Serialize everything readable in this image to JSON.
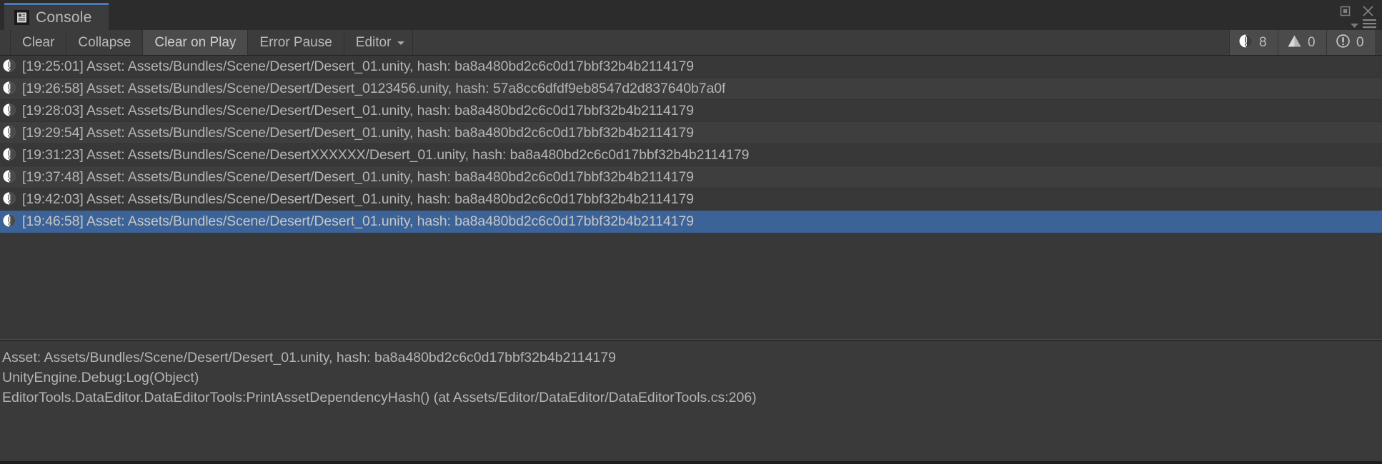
{
  "window": {
    "tab_label": "Console",
    "tab_icon": "console-document-icon",
    "maximize_icon": "maximize-icon",
    "close_icon": "close-icon",
    "menu_caret_icon": "chevron-down-icon",
    "menu_icon": "hamburger-menu-icon",
    "accent_color": "#4a7ab5"
  },
  "toolbar": {
    "clear_label": "Clear",
    "collapse_label": "Collapse",
    "clear_on_play_label": "Clear on Play",
    "error_pause_label": "Error Pause",
    "editor_label": "Editor",
    "editor_caret_icon": "caret-down-icon",
    "counters": [
      {
        "icon": "error-icon",
        "count": "8"
      },
      {
        "icon": "warning-icon",
        "count": "0"
      },
      {
        "icon": "info-icon",
        "count": "0"
      }
    ]
  },
  "log": {
    "entries": [
      {
        "icon": "error-icon",
        "message": "[19:25:01] Asset: Assets/Bundles/Scene/Desert/Desert_01.unity, hash: ba8a480bd2c6c0d17bbf32b4b2114179",
        "selected": false
      },
      {
        "icon": "error-icon",
        "message": "[19:26:58] Asset: Assets/Bundles/Scene/Desert/Desert_0123456.unity, hash: 57a8cc6dfdf9eb8547d2d837640b7a0f",
        "selected": false
      },
      {
        "icon": "error-icon",
        "message": "[19:28:03] Asset: Assets/Bundles/Scene/Desert/Desert_01.unity, hash: ba8a480bd2c6c0d17bbf32b4b2114179",
        "selected": false
      },
      {
        "icon": "error-icon",
        "message": "[19:29:54] Asset: Assets/Bundles/Scene/Desert/Desert_01.unity, hash: ba8a480bd2c6c0d17bbf32b4b2114179",
        "selected": false
      },
      {
        "icon": "error-icon",
        "message": "[19:31:23] Asset: Assets/Bundles/Scene/DesertXXXXXX/Desert_01.unity, hash: ba8a480bd2c6c0d17bbf32b4b2114179",
        "selected": false
      },
      {
        "icon": "error-icon",
        "message": "[19:37:48] Asset: Assets/Bundles/Scene/Desert/Desert_01.unity, hash: ba8a480bd2c6c0d17bbf32b4b2114179",
        "selected": false
      },
      {
        "icon": "error-icon",
        "message": "[19:42:03] Asset: Assets/Bundles/Scene/Desert/Desert_01.unity, hash: ba8a480bd2c6c0d17bbf32b4b2114179",
        "selected": false
      },
      {
        "icon": "error-icon",
        "message": "[19:46:58] Asset: Assets/Bundles/Scene/Desert/Desert_01.unity, hash: ba8a480bd2c6c0d17bbf32b4b2114179",
        "selected": true
      }
    ],
    "selection_color": "#3c6398"
  },
  "detail": {
    "line1": "Asset: Assets/Bundles/Scene/Desert/Desert_01.unity, hash: ba8a480bd2c6c0d17bbf32b4b2114179",
    "line2": "UnityEngine.Debug:Log(Object)",
    "line3": "EditorTools.DataEditor.DataEditorTools:PrintAssetDependencyHash() (at Assets/Editor/DataEditor/DataEditorTools.cs:206)"
  }
}
